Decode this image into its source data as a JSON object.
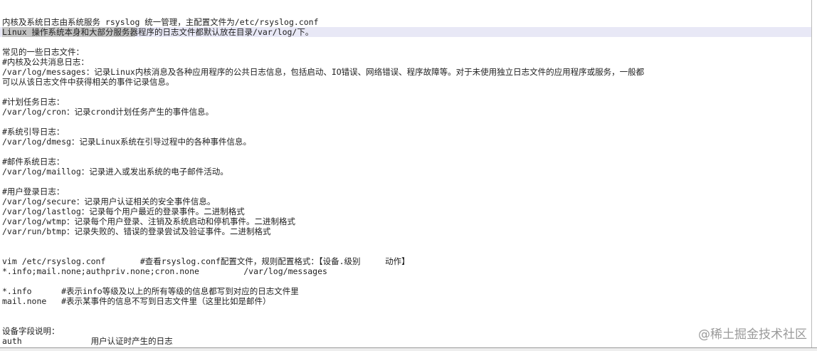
{
  "lines": [
    "内核及系统日志由系统服务 rsyslog 统一管理，主配置文件为/etc/rsyslog.conf",
    "Linux 操作系统本身和大部分服务器程序的日志文件都默认放在目录/var/log/下。",
    "常见的一些日志文件：",
    "#内核及公共消息日志：",
    "/var/log/messages：记录Linux内核消息及各种应用程序的公共日志信息，包括启动、IO错误、网络错误、程序故障等。对于未使用独立日志文件的应用程序或服务，一般都",
    "可以从该日志文件中获得相关的事件记录信息。",
    "#计划任务日志：",
    "/var/log/cron：记录crond计划任务产生的事件信息。",
    "#系统引导日志：",
    "/var/log/dmesg：记录Linux系统在引导过程中的各种事件信息。",
    "#邮件系统日志：",
    "/var/log/maillog：记录进入或发出系统的电子邮件活动。",
    "#用户登录日志：",
    "/var/log/secure：记录用户认证相关的安全事件信息。",
    "/var/log/lastlog：记录每个用户最近的登录事件。二进制格式",
    "/var/log/wtmp：记录每个用户登录、注销及系统启动和停机事件。二进制格式",
    "/var/run/btmp：记录失败的、错误的登录尝试及验证事件。二进制格式",
    "vim /etc/rsyslog.conf       #查看rsyslog.conf配置文件，规则配置格式：【设备.级别     动作】",
    "*.info;mail.none;authpriv.none;cron.none         /var/log/messages",
    "*.info      #表示info等级及以上的所有等级的信息都写到对应的日志文件里",
    "mail.none   #表示某事件的信息不写到日志文件里（这里比如是邮件）",
    "设备字段说明：",
    "auth              用户认证时产生的日志"
  ],
  "watermark": "@稀土掘金技术社区"
}
